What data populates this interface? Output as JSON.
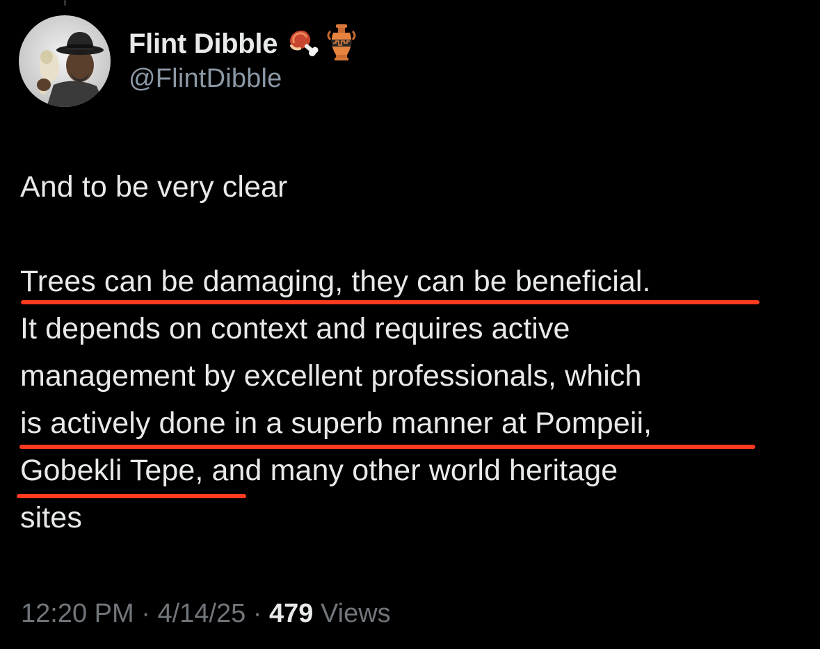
{
  "author": {
    "display_name": "Flint Dibble",
    "handle": "@FlintDibble",
    "badge_icons": [
      "meat-on-bone-icon",
      "amphora-icon"
    ]
  },
  "tweet": {
    "lines": [
      "And to be very clear",
      "",
      "Trees can be damaging, they can be beneficial.",
      "It depends on context and requires active",
      "management by excellent professionals, which",
      "is actively done in a superb manner at Pompeii,",
      "Gobekli Tepe, and many other world heritage",
      "sites"
    ]
  },
  "meta": {
    "time": "12:20 PM",
    "separator": "·",
    "date": "4/14/25",
    "views_count": "479",
    "views_label": "Views"
  },
  "annotation_color": "#ff3b1f"
}
